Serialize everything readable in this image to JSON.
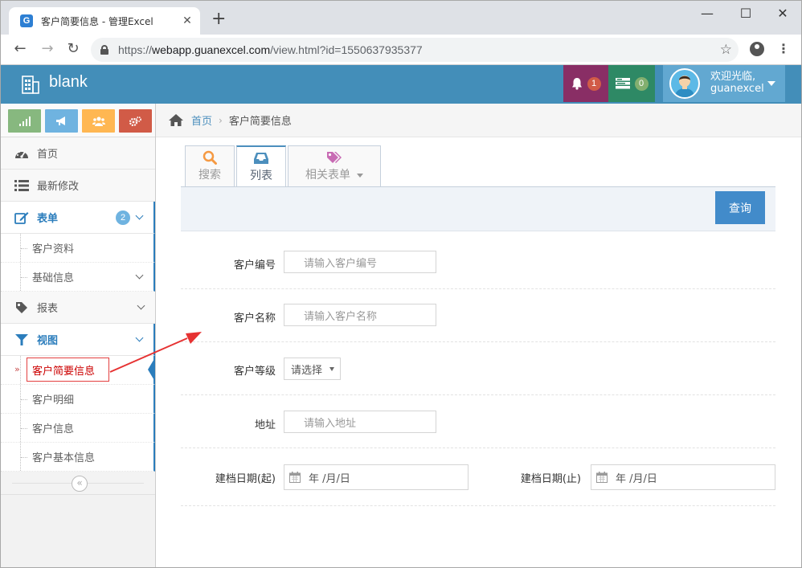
{
  "browser": {
    "tab_title": "客户简要信息 - 管理Excel",
    "favicon_letter": "G",
    "tab_close": "✕",
    "new_tab": "+",
    "url_scheme": "https://",
    "url_host": "webapp.guanexcel.com",
    "url_path": "/view.html?id=1550637935377",
    "window_controls": {
      "minimize": "—",
      "maximize": "☐",
      "close": "✕"
    },
    "nav": {
      "back": "←",
      "forward": "→",
      "reload": "↻",
      "bookmark": "☆",
      "menu": "⋮"
    }
  },
  "header": {
    "brand": "blank",
    "notifications_count": "1",
    "tasks_count": "0",
    "user_greeting": "欢迎光临,",
    "user_name": "guanexcel",
    "colors": {
      "header": "#438eb9",
      "notif": "#892e65",
      "task": "#2e8965",
      "user": "#62a8d1"
    }
  },
  "sidebar": {
    "shortcuts": [
      {
        "name": "signal-icon",
        "color": "#87b87f"
      },
      {
        "name": "bullhorn-icon",
        "color": "#6fb3e0"
      },
      {
        "name": "users-icon",
        "color": "#ffb752"
      },
      {
        "name": "cogs-icon",
        "color": "#d15b47"
      }
    ],
    "items": [
      {
        "label": "首页",
        "icon": "dashboard-icon"
      },
      {
        "label": "最新修改",
        "icon": "list-icon"
      },
      {
        "label": "表单",
        "icon": "edit-icon",
        "count": "2"
      },
      {
        "label": "报表",
        "icon": "tag-icon"
      },
      {
        "label": "视图",
        "icon": "filter-icon"
      }
    ],
    "form_sub": [
      {
        "label": "客户资料"
      },
      {
        "label": "基础信息"
      }
    ],
    "view_sub": [
      {
        "label": "客户简要信息"
      },
      {
        "label": "客户明细"
      },
      {
        "label": "客户信息"
      },
      {
        "label": "客户基本信息"
      }
    ],
    "active_marker": "»",
    "collapse": "«"
  },
  "breadcrumb": {
    "home": "首页",
    "separator": "›",
    "current": "客户简要信息"
  },
  "tabs": [
    {
      "label": "搜索",
      "icon": "search-icon"
    },
    {
      "label": "列表",
      "icon": "inbox-icon"
    },
    {
      "label": "相关表单",
      "icon": "tags-icon"
    }
  ],
  "toolbar": {
    "query_label": "查询"
  },
  "form": {
    "customer_no": {
      "label": "客户编号",
      "placeholder": "请输入客户编号"
    },
    "customer_name": {
      "label": "客户名称",
      "placeholder": "请输入客户名称"
    },
    "customer_level": {
      "label": "客户等级",
      "value": "请选择"
    },
    "address": {
      "label": "地址",
      "placeholder": "请输入地址"
    },
    "date_start": {
      "label": "建档日期(起)",
      "placeholder": "年 /月/日"
    },
    "date_end": {
      "label": "建档日期(止)",
      "placeholder": "年 /月/日"
    }
  }
}
